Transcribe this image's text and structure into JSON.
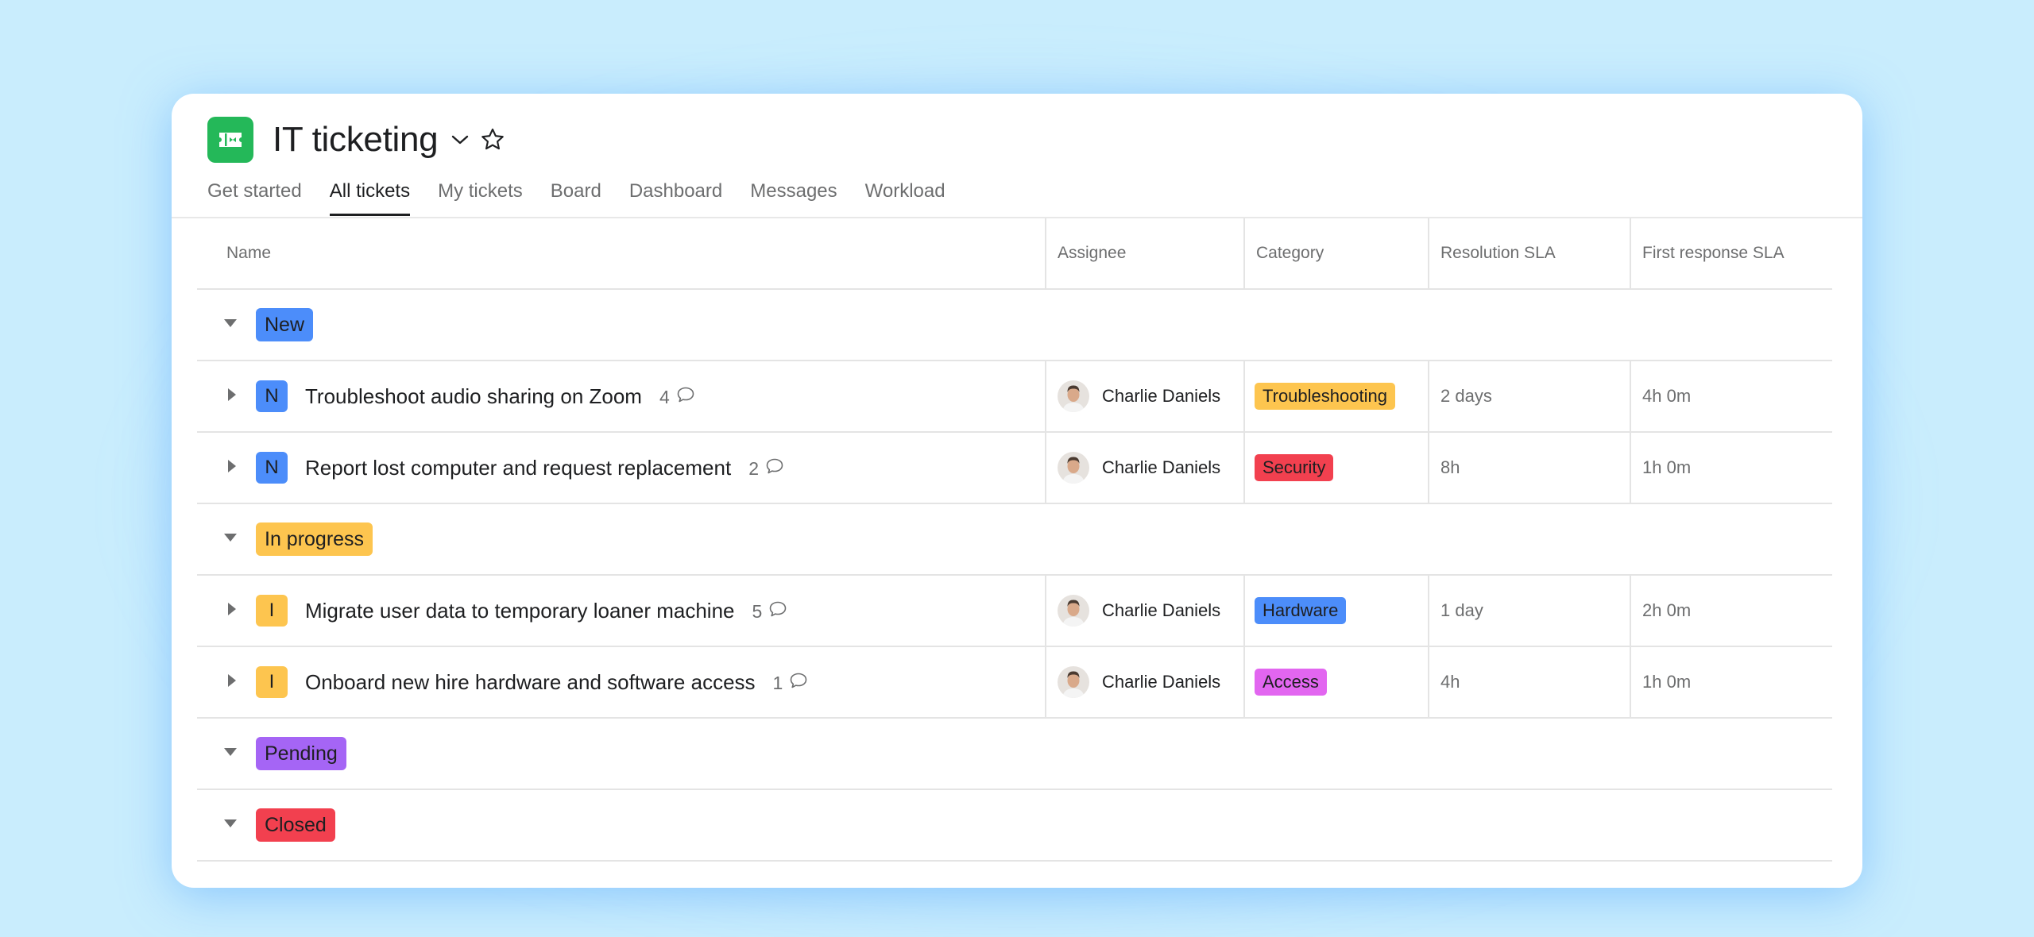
{
  "project": {
    "title": "IT ticketing",
    "icon": "ticket-icon",
    "icon_color": "#24b859"
  },
  "tabs": [
    {
      "label": "Get started",
      "active": false
    },
    {
      "label": "All tickets",
      "active": true
    },
    {
      "label": "My tickets",
      "active": false
    },
    {
      "label": "Board",
      "active": false
    },
    {
      "label": "Dashboard",
      "active": false
    },
    {
      "label": "Messages",
      "active": false
    },
    {
      "label": "Workload",
      "active": false
    }
  ],
  "columns": {
    "name": "Name",
    "assignee": "Assignee",
    "category": "Category",
    "resolution": "Resolution SLA",
    "first_response": "First response SLA"
  },
  "groups": [
    {
      "label": "New",
      "color": "#4c8dfa",
      "tasks": [
        {
          "initial": "N",
          "initial_color": "#4c8dfa",
          "name": "Troubleshoot audio sharing on Zoom",
          "comments": "4",
          "assignee": "Charlie Daniels",
          "category": "Troubleshooting",
          "category_color": "#fdc54f",
          "resolution": "2 days",
          "first_response": "4h 0m"
        },
        {
          "initial": "N",
          "initial_color": "#4c8dfa",
          "name": "Report lost computer and request replacement",
          "comments": "2",
          "assignee": "Charlie Daniels",
          "category": "Security",
          "category_color": "#f2404f",
          "resolution": "8h",
          "first_response": "1h 0m"
        }
      ]
    },
    {
      "label": "In progress",
      "color": "#fdc54f",
      "tasks": [
        {
          "initial": "I",
          "initial_color": "#fdc54f",
          "name": "Migrate user data to temporary loaner machine",
          "comments": "5",
          "assignee": "Charlie Daniels",
          "category": "Hardware",
          "category_color": "#4c8dfa",
          "resolution": "1 day",
          "first_response": "2h 0m"
        },
        {
          "initial": "I",
          "initial_color": "#fdc54f",
          "name": "Onboard new hire hardware and software access",
          "comments": "1",
          "assignee": "Charlie Daniels",
          "category": "Access",
          "category_color": "#e266f0",
          "resolution": "4h",
          "first_response": "1h 0m"
        }
      ]
    },
    {
      "label": "Pending",
      "color": "#a565f5",
      "tasks": []
    },
    {
      "label": "Closed",
      "color": "#f2404f",
      "tasks": []
    }
  ]
}
